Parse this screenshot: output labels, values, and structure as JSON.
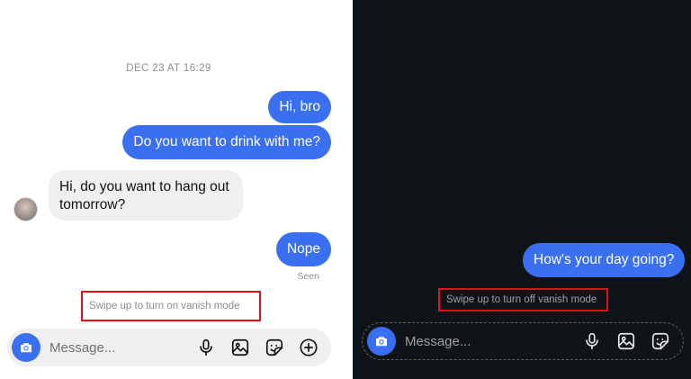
{
  "light": {
    "timestamp": "DEC 23 AT 16:29",
    "messages": [
      {
        "text": "Hi, bro",
        "direction": "outgoing"
      },
      {
        "text": "Do you want to drink with me?",
        "direction": "outgoing"
      },
      {
        "text": "Hi, do you want to hang out tomorrow?",
        "direction": "incoming"
      },
      {
        "text": "Nope",
        "direction": "outgoing"
      }
    ],
    "seen": "Seen",
    "vanish_hint": "Swipe up to turn on vanish mode",
    "composer": {
      "placeholder": "Message...",
      "icons": [
        "camera-icon",
        "microphone-icon",
        "gallery-icon",
        "sticker-icon",
        "add-icon"
      ]
    }
  },
  "dark": {
    "messages": [
      {
        "text": "How's your day going?",
        "direction": "outgoing"
      }
    ],
    "vanish_hint": "Swipe up to turn off vanish mode",
    "composer": {
      "placeholder": "Message...",
      "icons": [
        "camera-icon",
        "microphone-icon",
        "gallery-icon",
        "sticker-icon"
      ]
    }
  },
  "colors": {
    "accent": "#3a6ff0",
    "highlight_border": "#e0101c",
    "dark_bg": "#0f1419",
    "incoming_bubble": "#efefef"
  }
}
